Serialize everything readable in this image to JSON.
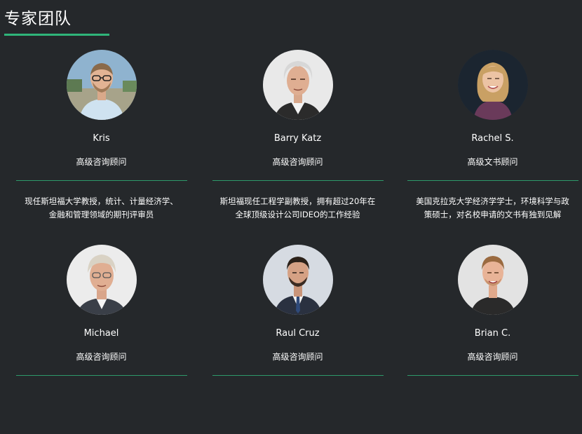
{
  "section": {
    "title": "专家团队"
  },
  "colors": {
    "background": "#25282b",
    "accent": "#2fb57a",
    "text": "#ffffff"
  },
  "experts": [
    {
      "name": "Kris",
      "role": "高级咨询顾问",
      "desc_line1": "现任斯坦福大学教授，统计、计量经济学、",
      "desc_line2": "金融和管理领域的期刊评审员"
    },
    {
      "name": "Barry Katz",
      "role": "高级咨询顾问",
      "desc_line1": "斯坦福现任工程学副教授，拥有超过20年在",
      "desc_line2": "全球顶级设计公司IDEO的工作经验"
    },
    {
      "name": "Rachel S.",
      "role": "高级文书顾问",
      "desc_line1": "美国克拉克大学经济学学士，环境科学与政",
      "desc_line2": "策硕士，对名校申请的文书有独到见解"
    },
    {
      "name": "Michael",
      "role": "高级咨询顾问"
    },
    {
      "name": "Raul Cruz",
      "role": "高级咨询顾问"
    },
    {
      "name": "Brian C.",
      "role": "高级咨询顾问"
    }
  ]
}
